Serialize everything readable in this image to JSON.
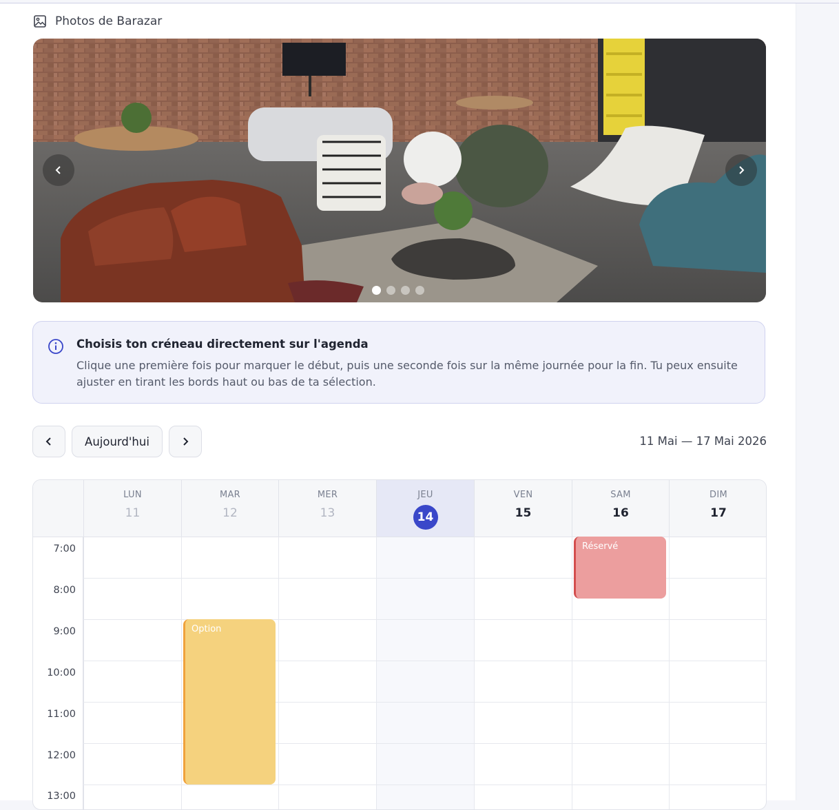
{
  "photos": {
    "title": "Photos de Barazar",
    "slide_count": 4,
    "active_slide": 1
  },
  "info": {
    "title": "Choisis ton créneau directement sur l'agenda",
    "text": "Clique une première fois pour marquer le début, puis une seconde fois sur la même journée pour la fin. Tu peux ensuite ajuster en tirant les bords haut ou bas de ta sélection."
  },
  "nav": {
    "today_label": "Aujourd'hui",
    "range": "11 Mai — 17 Mai 2026"
  },
  "calendar": {
    "days": [
      {
        "name": "LUN",
        "num": "11"
      },
      {
        "name": "MAR",
        "num": "12"
      },
      {
        "name": "MER",
        "num": "13"
      },
      {
        "name": "JEU",
        "num": "14"
      },
      {
        "name": "VEN",
        "num": "15"
      },
      {
        "name": "SAM",
        "num": "16"
      },
      {
        "name": "DIM",
        "num": "17"
      }
    ],
    "hours": [
      "7:00",
      "8:00",
      "9:00",
      "10:00",
      "11:00",
      "12:00",
      "13:00"
    ],
    "events": {
      "reserved": "Réservé",
      "option": "Option"
    }
  },
  "colors": {
    "accent": "#3a47c9",
    "reserved": "#ec9e9e",
    "option": "#f5d27e"
  }
}
